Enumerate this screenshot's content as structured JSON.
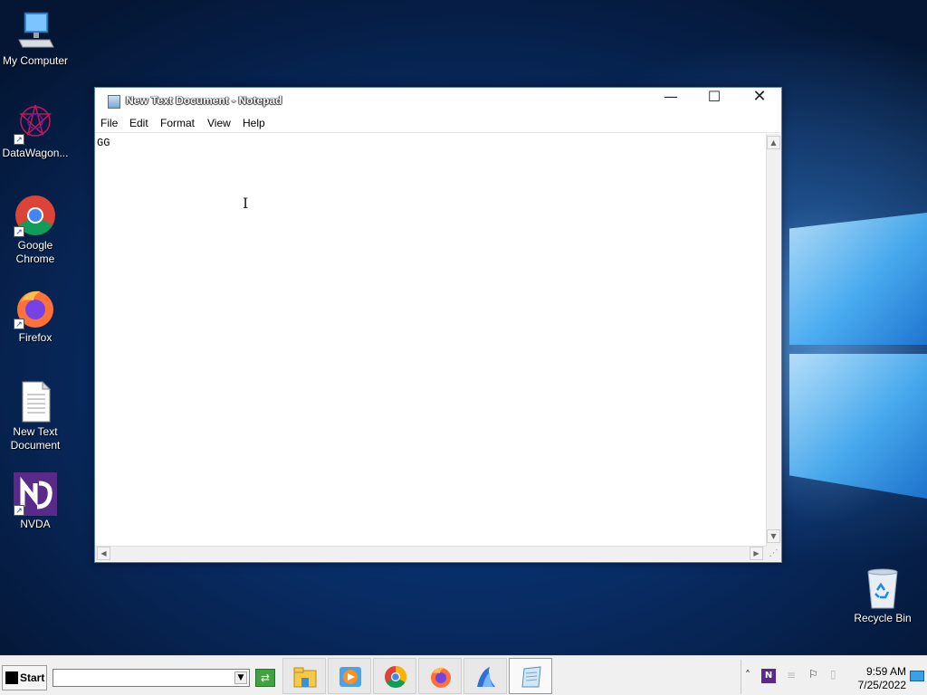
{
  "desktop": {
    "icons": [
      {
        "label": "My Computer",
        "icon": "computer-icon"
      },
      {
        "label": "DataWagon...",
        "icon": "datawagon-icon"
      },
      {
        "label": "Google Chrome",
        "icon": "chrome-icon"
      },
      {
        "label": "Firefox",
        "icon": "firefox-icon"
      },
      {
        "label": "New Text Document",
        "icon": "text-document-icon"
      },
      {
        "label": "NVDA",
        "icon": "nvda-icon"
      },
      {
        "label": "Recycle Bin",
        "icon": "recycle-bin-icon"
      }
    ]
  },
  "notepad": {
    "title": "New Text Document - Notepad",
    "controls": {
      "minimize": "—",
      "maximize": "☐",
      "close": "✕"
    },
    "menu": [
      "File",
      "Edit",
      "Format",
      "View",
      "Help"
    ],
    "content": "GG"
  },
  "taskbar": {
    "start_label": "Start",
    "address_value": "",
    "apps": [
      "file-explorer-icon",
      "media-player-icon",
      "chrome-icon",
      "firefox-icon",
      "app-icon",
      "notepad-icon"
    ],
    "tray": {
      "time": "9:59 AM",
      "date": "7/25/2022"
    }
  },
  "colors": {
    "desktop_bg": "#082a60",
    "taskbar_bg": "#f0f0f0",
    "accent": "#3aa0e8"
  }
}
